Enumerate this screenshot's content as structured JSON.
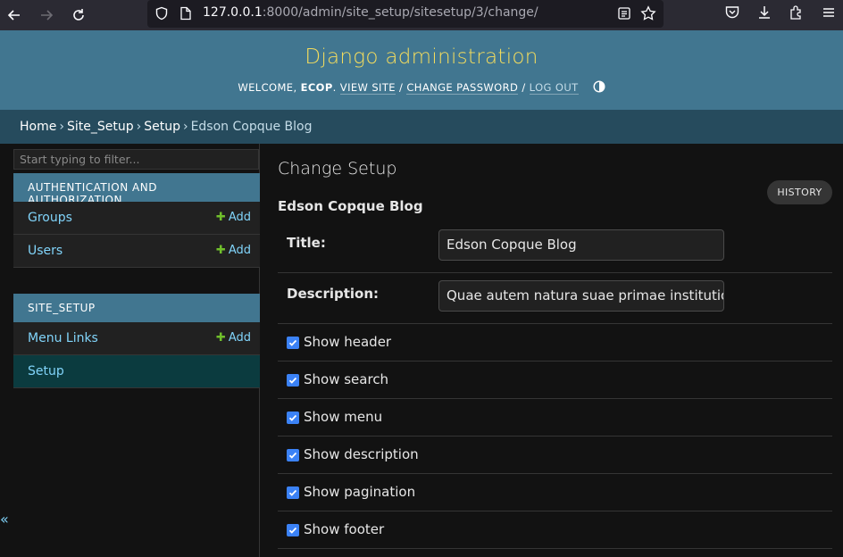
{
  "browser": {
    "url_host": "127.0.0.1",
    "url_rest": ":8000/admin/site_setup/sitesetup/3/change/"
  },
  "header": {
    "branding": "Django administration",
    "welcome": "WELCOME,",
    "username": "ECOP",
    "view_site": "VIEW SITE",
    "change_password": "CHANGE PASSWORD",
    "log_out": "LOG OUT",
    "separator": "/"
  },
  "breadcrumbs": {
    "items": [
      "Home",
      "Site_Setup",
      "Setup",
      "Edson Copque Blog"
    ],
    "separator": "›"
  },
  "sidebar": {
    "filter_placeholder": "Start typing to filter...",
    "modules": [
      {
        "caption": "AUTHENTICATION AND AUTHORIZATION",
        "models": [
          {
            "name": "Groups",
            "add_label": "Add"
          },
          {
            "name": "Users",
            "add_label": "Add"
          }
        ]
      },
      {
        "caption": "SITE_SETUP",
        "models": [
          {
            "name": "Menu Links",
            "add_label": "Add"
          },
          {
            "name": "Setup",
            "add_label": ""
          }
        ]
      }
    ],
    "collapse_label": "«"
  },
  "content": {
    "title": "Change Setup",
    "history_label": "HISTORY",
    "object_name": "Edson Copque Blog",
    "fields": {
      "title_label": "Title:",
      "title_value": "Edson Copque Blog",
      "description_label": "Description:",
      "description_value": "Quae autem natura suae primae institution"
    },
    "checkboxes": [
      {
        "label": "Show header",
        "checked": true
      },
      {
        "label": "Show search",
        "checked": true
      },
      {
        "label": "Show menu",
        "checked": true
      },
      {
        "label": "Show description",
        "checked": true
      },
      {
        "label": "Show pagination",
        "checked": true
      },
      {
        "label": "Show footer",
        "checked": true
      }
    ]
  },
  "colors": {
    "header_bg": "#417690",
    "branding": "#f5dd5d",
    "breadcrumbs_bg": "#264b5d",
    "link": "#81d4fa",
    "add_plus": "#70bf2b",
    "checkbox": "#3b82f6",
    "current_model_bg": "#0b3b3f"
  }
}
